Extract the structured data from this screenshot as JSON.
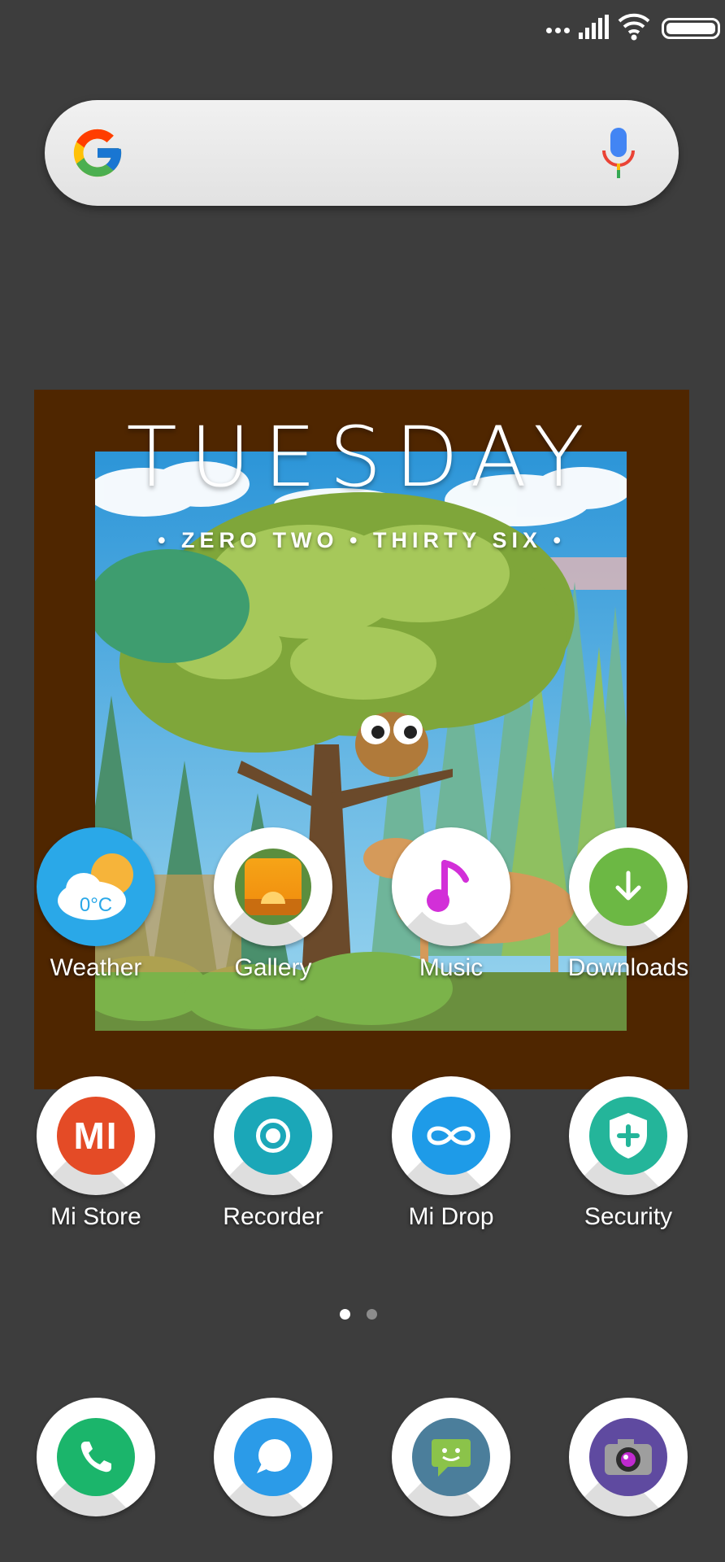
{
  "widget": {
    "day": "TUESDAY",
    "time_words": "• ZERO TWO • THIRTY SIX •"
  },
  "apps_row1": [
    {
      "label": "Weather",
      "icon": "weather-icon",
      "badge": "0°C",
      "color": "#2aa8e8"
    },
    {
      "label": "Gallery",
      "icon": "gallery-icon",
      "color": "#f29a17"
    },
    {
      "label": "Music",
      "icon": "music-note-icon",
      "color": "#d22fd8"
    },
    {
      "label": "Downloads",
      "icon": "download-icon",
      "color": "#6cb844"
    }
  ],
  "apps_row2": [
    {
      "label": "Mi Store",
      "icon": "mi-logo-icon",
      "color": "#e44b26"
    },
    {
      "label": "Recorder",
      "icon": "recorder-icon",
      "color": "#1ba7b8"
    },
    {
      "label": "Mi Drop",
      "icon": "infinity-icon",
      "color": "#1e9be8"
    },
    {
      "label": "Security",
      "icon": "shield-icon",
      "color": "#24b59a"
    }
  ],
  "dock": [
    {
      "icon": "phone-icon",
      "color": "#1bb56b"
    },
    {
      "icon": "chat-bubble-icon",
      "color": "#2b9be8"
    },
    {
      "icon": "messaging-icon",
      "color": "#8bc34a"
    },
    {
      "icon": "camera-icon",
      "color": "#5f4aa0"
    }
  ],
  "pagination": {
    "count": 2,
    "active": 0
  },
  "colors": {
    "background": "#3d3d3d",
    "widget_frame": "#4f2600"
  }
}
